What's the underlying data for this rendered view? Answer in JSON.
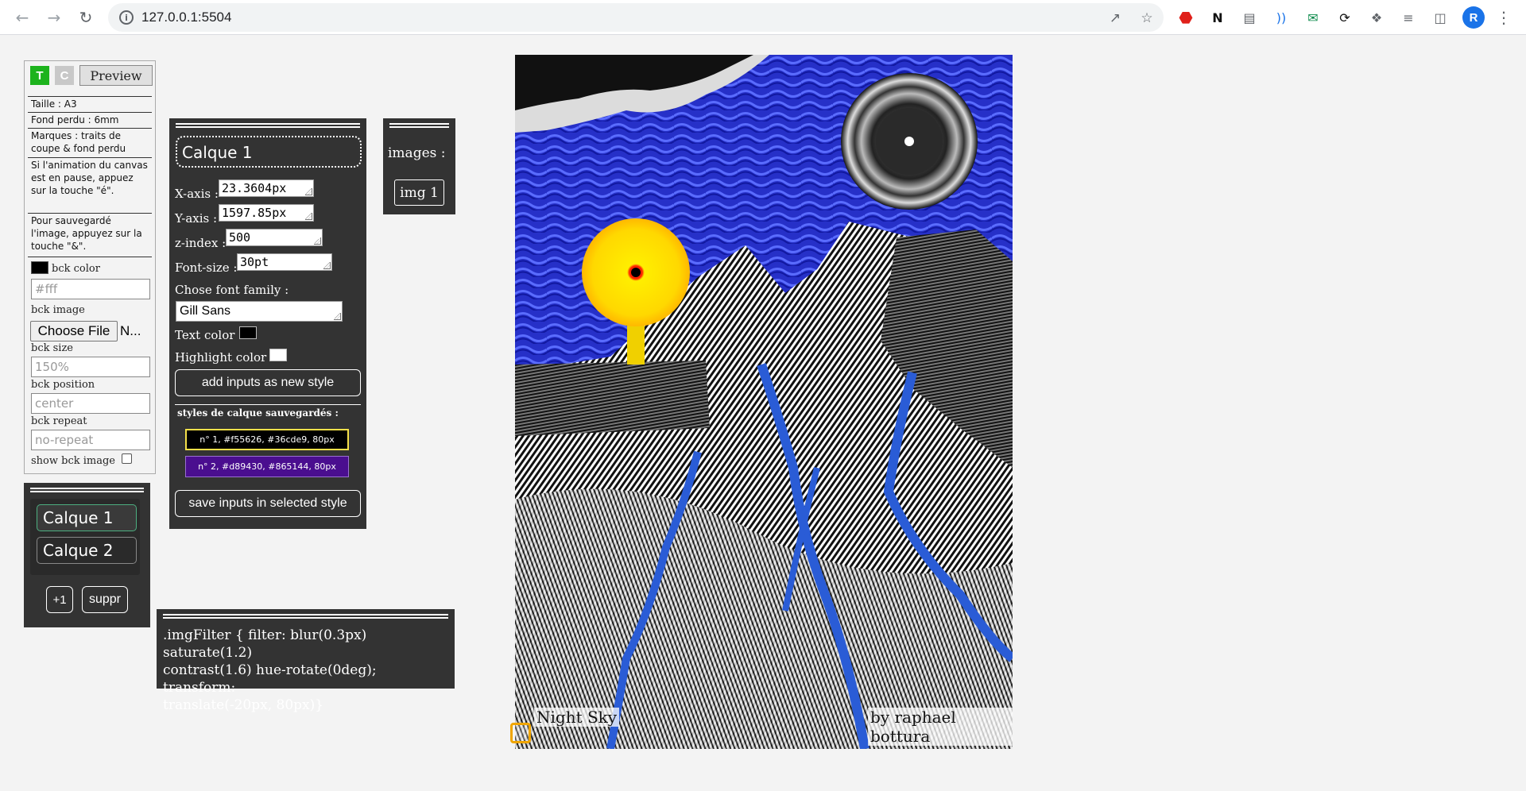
{
  "browser": {
    "url": "127.0.0.1:5504",
    "profile_initial": "R",
    "icons": {
      "back": "arrow-left-icon",
      "forward": "arrow-right-icon",
      "reload": "reload-icon",
      "site_info": "info-icon",
      "share": "share-icon",
      "bookmark": "star-icon"
    }
  },
  "settings": {
    "mode_buttons": [
      "T",
      "C"
    ],
    "preview_label": "Preview",
    "info": {
      "size": "Taille : A3",
      "bleed": "Fond perdu : 6mm",
      "marks": "Marques : traits de coupe & fond perdu",
      "pause_hint": "Si l'animation du canvas est en pause, appuez sur la touche \"é\".",
      "save_hint": "Pour sauvegardé l'image, appuyez sur la touche \"&\"."
    },
    "bck_color_label": "bck color",
    "bck_color_placeholder": "#fff",
    "bck_color_swatch": "#000000",
    "bck_image_label": "bck image",
    "choose_file_label": "Choose File",
    "file_name": "N...",
    "bck_size_label": "bck size",
    "bck_size_placeholder": "150%",
    "bck_position_label": "bck position",
    "bck_position_placeholder": "center",
    "bck_repeat_label": "bck repeat",
    "bck_repeat_placeholder": "no-repeat",
    "show_bck_image_label": "show bck image"
  },
  "layers": {
    "items": [
      "Calque 1",
      "Calque 2"
    ],
    "selected": "Calque 1",
    "add_label": "+1",
    "delete_label": "suppr"
  },
  "layer_props": {
    "title": "Calque 1",
    "x_axis_label": "X-axis :",
    "x_axis_value": "23.3604px",
    "y_axis_label": "Y-axis :",
    "y_axis_value": "1597.85px",
    "z_index_label": "z-index :",
    "z_index_value": "500",
    "font_size_label": "Font-size :",
    "font_size_value": "30pt",
    "font_family_label": "Chose font family :",
    "font_family_value": "Gill Sans",
    "text_color_label": "Text color :",
    "text_color": "#000000",
    "highlight_color_label": "Highlight color :",
    "highlight_color": "#ffffff",
    "add_style_label": "add inputs as new style",
    "saved_styles_label": "styles de calque sauvegardés :",
    "saved_styles": [
      {
        "label": "n° 1, #f55626, #36cde9, 80px",
        "bg": "#000000",
        "border": "#f5e04a"
      },
      {
        "label": "n° 2, #d89430, #865144, 80px",
        "bg": "#4a0e8f",
        "border": "#9a70d0"
      }
    ],
    "save_style_label": "save inputs in selected style"
  },
  "images": {
    "title": "images :",
    "items": [
      "img 1"
    ]
  },
  "css_filter": {
    "line1": ".imgFilter { filter: blur(0.3px) saturate(1.2)",
    "line2": "contrast(1.6) hue-rotate(0deg); transform:",
    "line3": "translate(-20px, 80px)}"
  },
  "poster": {
    "title": "Night Sky",
    "credit": "by raphael bottura",
    "accent_blue": "#2a33d8",
    "sun_yellow": "#ffe000"
  }
}
